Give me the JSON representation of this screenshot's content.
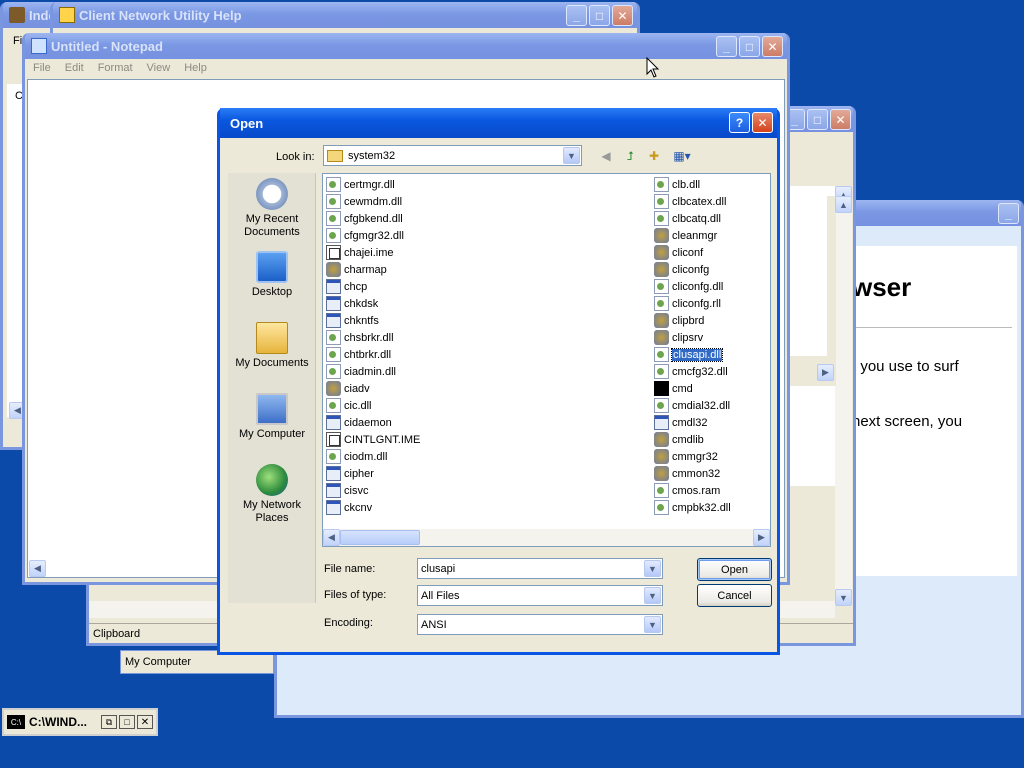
{
  "background_windows": {
    "index_title": "Inde",
    "client_help_title": "Client Network Utility Help",
    "notepad_title": "Untitled - Notepad",
    "notepad_menu": [
      "File",
      "Edit",
      "Format",
      "View",
      "Help"
    ],
    "left_window_menu_initial": "Fi",
    "left_window_letter": "C",
    "browser_heading": "wser",
    "browser_text_1": "t you use to surf",
    "browser_text_2": "next screen, you",
    "browser_text_3": ".",
    "clipboard_status": "Clipboard",
    "mycomputer_status": "My Computer"
  },
  "taskbar_item": {
    "label": "C:\\WIND..."
  },
  "dialog": {
    "title": "Open",
    "look_in_label": "Look in:",
    "look_in_value": "system32",
    "places": [
      {
        "label": "My Recent Documents",
        "icon": "recent-documents-icon"
      },
      {
        "label": "Desktop",
        "icon": "desktop-icon"
      },
      {
        "label": "My Documents",
        "icon": "my-documents-icon"
      },
      {
        "label": "My Computer",
        "icon": "my-computer-icon"
      },
      {
        "label": "My Network Places",
        "icon": "network-places-icon"
      }
    ],
    "files_col1": [
      "certmgr.dll",
      "cewmdm.dll",
      "cfgbkend.dll",
      "cfgmgr32.dll",
      "chajei.ime",
      "charmap",
      "chcp",
      "chkdsk",
      "chkntfs",
      "chsbrkr.dll",
      "chtbrkr.dll",
      "ciadmin.dll",
      "ciadv",
      "cic.dll",
      "cidaemon",
      "CINTLGNT.IME",
      "ciodm.dll",
      "cipher",
      "cisvc",
      "ckcnv"
    ],
    "files_col2": [
      "clb.dll",
      "clbcatex.dll",
      "clbcatq.dll",
      "cleanmgr",
      "cliconf",
      "cliconfg",
      "cliconfg.dll",
      "cliconfg.rll",
      "clipbrd",
      "clipsrv",
      "clusapi.dll",
      "cmcfg32.dll",
      "cmd",
      "cmdial32.dll",
      "cmdl32",
      "cmdlib",
      "cmmgr32",
      "cmmon32",
      "cmos.ram",
      "cmpbk32.dll"
    ],
    "selected_file": "clusapi.dll",
    "file_name_label": "File name:",
    "file_name_value": "clusapi",
    "files_of_type_label": "Files of type:",
    "files_of_type_value": "All Files",
    "encoding_label": "Encoding:",
    "encoding_value": "ANSI",
    "open_button": "Open",
    "cancel_button": "Cancel",
    "help_button": "?"
  },
  "colors": {
    "desktop": "#0b4aa8",
    "titlebar_active": "#0a58e0",
    "titlebar_inactive": "#7b98e4",
    "selection": "#316ac5"
  }
}
